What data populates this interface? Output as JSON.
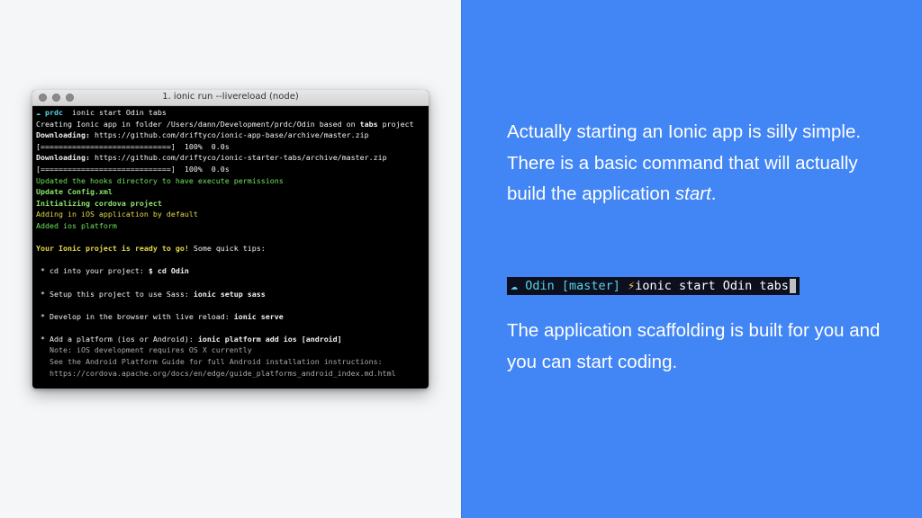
{
  "terminal": {
    "title": "1. ionic run --livereload (node)",
    "lines": [
      {
        "segments": [
          {
            "text": "☁ ",
            "cls": "cyan"
          },
          {
            "text": "prdc ",
            "cls": "cyan bold"
          },
          {
            "text": " ionic start Odin tabs",
            "cls": "white"
          }
        ]
      },
      {
        "segments": [
          {
            "text": "Creating Ionic app in folder /Users/dann/Development/prdc/Odin based on ",
            "cls": "white"
          },
          {
            "text": "tabs",
            "cls": "white bold"
          },
          {
            "text": " project",
            "cls": "white"
          }
        ]
      },
      {
        "segments": [
          {
            "text": "Downloading:",
            "cls": "white bold"
          },
          {
            "text": " https://github.com/driftyco/ionic-app-base/archive/master.zip",
            "cls": "white"
          }
        ]
      },
      {
        "segments": [
          {
            "text": "[=============================]  100%  0.0s",
            "cls": "white"
          }
        ]
      },
      {
        "segments": [
          {
            "text": "Downloading:",
            "cls": "white bold"
          },
          {
            "text": " https://github.com/driftyco/ionic-starter-tabs/archive/master.zip",
            "cls": "white"
          }
        ]
      },
      {
        "segments": [
          {
            "text": "[=============================]  100%  0.0s",
            "cls": "white"
          }
        ]
      },
      {
        "segments": [
          {
            "text": "Updated the hooks directory to have execute permissions",
            "cls": "green"
          }
        ]
      },
      {
        "segments": [
          {
            "text": "Update Config.xml",
            "cls": "lgreen bold"
          }
        ]
      },
      {
        "segments": [
          {
            "text": "Initializing cordova project",
            "cls": "lgreen bold"
          }
        ]
      },
      {
        "segments": [
          {
            "text": "Adding in iOS application by default",
            "cls": "yellow"
          }
        ]
      },
      {
        "segments": [
          {
            "text": "Added ios platform",
            "cls": "green"
          }
        ]
      },
      {
        "segments": [
          {
            "text": "",
            "cls": "white"
          }
        ]
      },
      {
        "segments": [
          {
            "text": "Your Ionic project is ready to go!",
            "cls": "yellow bold"
          },
          {
            "text": " Some quick tips:",
            "cls": "white"
          }
        ]
      },
      {
        "segments": [
          {
            "text": "",
            "cls": "white"
          }
        ]
      },
      {
        "segments": [
          {
            "text": " * cd into your project: ",
            "cls": "white"
          },
          {
            "text": "$ cd Odin",
            "cls": "white bold"
          }
        ]
      },
      {
        "segments": [
          {
            "text": "",
            "cls": "white"
          }
        ]
      },
      {
        "segments": [
          {
            "text": " * Setup this project to use Sass: ",
            "cls": "white"
          },
          {
            "text": "ionic setup sass",
            "cls": "white bold"
          }
        ]
      },
      {
        "segments": [
          {
            "text": "",
            "cls": "white"
          }
        ]
      },
      {
        "segments": [
          {
            "text": " * Develop in the browser with live reload: ",
            "cls": "white"
          },
          {
            "text": "ionic serve",
            "cls": "white bold"
          }
        ]
      },
      {
        "segments": [
          {
            "text": "",
            "cls": "white"
          }
        ]
      },
      {
        "segments": [
          {
            "text": " * Add a platform (ios or Android): ",
            "cls": "white"
          },
          {
            "text": "ionic platform add ios [android]",
            "cls": "white bold"
          }
        ]
      },
      {
        "segments": [
          {
            "text": "   Note: iOS development requires OS X currently",
            "cls": "gray"
          }
        ]
      },
      {
        "segments": [
          {
            "text": "   See the Android Platform Guide for full Android installation instructions:",
            "cls": "gray"
          }
        ]
      },
      {
        "segments": [
          {
            "text": "   https://cordova.apache.org/docs/en/edge/guide_platforms_android_index.md.html",
            "cls": "gray"
          }
        ]
      }
    ]
  },
  "slide": {
    "para1_prefix": "Actually starting an Ionic app is silly simple. There is a basic command that will actually build the application ",
    "para1_em": "start",
    "para1_suffix": ".",
    "cmd": {
      "cloud": "☁",
      "dir": " Odin [master] ",
      "bolt": "⚡",
      "command": "ionic start Odin tabs"
    },
    "para2": "The application scaffolding is built for you and you can start coding."
  },
  "colors": {
    "right_bg": "#4285f4",
    "left_bg": "#f5f6f8"
  }
}
